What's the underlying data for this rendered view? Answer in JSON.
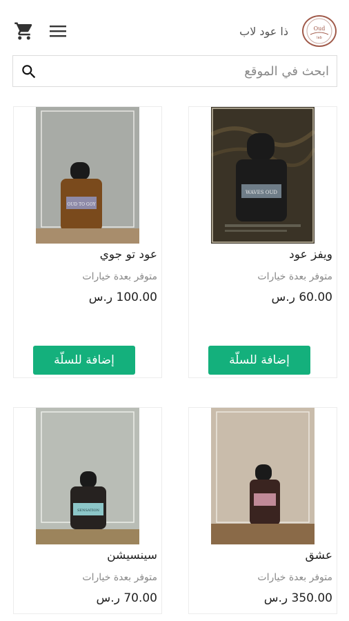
{
  "header": {
    "brand_name": "ذا عود لاب",
    "logo_alt": "The Oud Lab logo",
    "icons": {
      "cart": "shopping-cart-icon",
      "menu": "hamburger-menu-icon",
      "search": "search-icon"
    }
  },
  "search": {
    "placeholder": "ابحث في الموقع",
    "value": ""
  },
  "colors": {
    "accent": "#14b07c",
    "logo_ring": "#a05a4a"
  },
  "products": [
    {
      "name": "ويفز عود",
      "availability": "متوفر بعدة خيارات",
      "price": "60.00 ر.س",
      "button": "إضافة للسلّة",
      "label_text": "WAVES OUD"
    },
    {
      "name": "عود تو جوي",
      "availability": "متوفر بعدة خيارات",
      "price": "100.00 ر.س",
      "button": "إضافة للسلّة",
      "label_text": "OUD TO GOY"
    },
    {
      "name": "عشق",
      "availability": "متوفر بعدة خيارات",
      "price": "350.00 ر.س",
      "button": "إضافة للسلّة",
      "label_text": ""
    },
    {
      "name": "سينسيشن",
      "availability": "متوفر بعدة خيارات",
      "price": "70.00 ر.س",
      "button": "إضافة للسلّة",
      "label_text": "SENSATION"
    }
  ]
}
